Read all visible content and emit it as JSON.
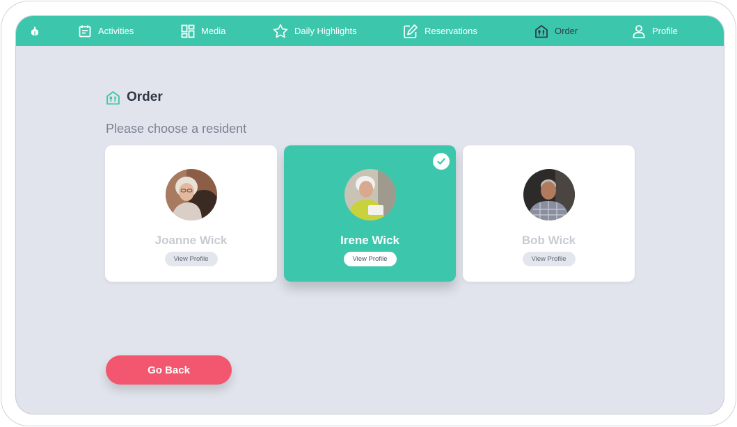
{
  "nav": {
    "items": [
      {
        "label": "",
        "icon": "home-logo-icon"
      },
      {
        "label": "Activities",
        "icon": "calendar-icon"
      },
      {
        "label": "Media",
        "icon": "dashboard-icon"
      },
      {
        "label": "Daily Highlights",
        "icon": "star-icon"
      },
      {
        "label": "Reservations",
        "icon": "edit-icon"
      },
      {
        "label": "Order",
        "icon": "restaurant-house-icon",
        "active": true
      },
      {
        "label": "Profile",
        "icon": "person-icon"
      }
    ]
  },
  "page": {
    "title": "Order",
    "subtitle": "Please choose a resident"
  },
  "residents": [
    {
      "name": "Joanne Wick",
      "button": "View Profile",
      "selected": false
    },
    {
      "name": "Irene Wick",
      "button": "View Profile",
      "selected": true
    },
    {
      "name": "Bob Wick",
      "button": "View Profile",
      "selected": false
    }
  ],
  "actions": {
    "go_back": "Go Back"
  },
  "colors": {
    "accent": "#3cc7ad",
    "background": "#e1e4ec",
    "danger": "#f2576f",
    "text_dark": "#2f3643"
  }
}
